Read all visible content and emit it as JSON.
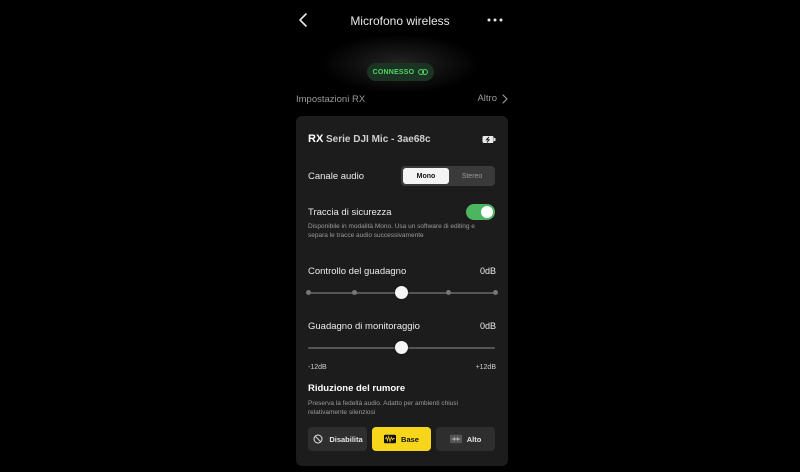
{
  "header": {
    "title": "Microfono wireless",
    "back_icon": "chevron-left-icon",
    "more_icon": "more-horizontal-icon"
  },
  "status": {
    "label": "CONNESSO",
    "icon": "link-icon",
    "color": "#54d26a"
  },
  "section": {
    "title": "Impostazioni RX",
    "more_label": "Altro",
    "more_icon": "chevron-right-icon"
  },
  "device": {
    "badge": "RX",
    "name": "Serie DJI Mic - 3ae68c",
    "battery_icon": "battery-charging-icon"
  },
  "audio_channel": {
    "label": "Canale audio",
    "options": [
      "Mono",
      "Stereo"
    ],
    "selected": "Mono"
  },
  "safety_track": {
    "label": "Traccia di sicurezza",
    "enabled": true,
    "description_line1": "Disponibile in modalità Mono. Usa un software di editing e",
    "description_line2": "separa le tracce audio successivamente",
    "toggle_color": "#4cb560"
  },
  "gain_control": {
    "label": "Controllo del guadagno",
    "value": "0dB",
    "steps": 5,
    "selected_step_fraction": 0.5
  },
  "monitor_gain": {
    "label": "Guadagno di monitoraggio",
    "value": "0dB",
    "min_label": "-12dB",
    "max_label": "+12dB",
    "level_fraction": 0.5
  },
  "noise_reduction": {
    "title": "Riduzione del rumore",
    "description_line1": "Preserva la fedeltà audio. Adatto per ambienti chiusi",
    "description_line2": "relativamente silenziosi",
    "options": [
      {
        "label": "Disabilita",
        "icon": "disabled-icon"
      },
      {
        "label": "Base",
        "icon": "waveform-basic-icon"
      },
      {
        "label": "Alto",
        "icon": "waveform-high-icon"
      }
    ],
    "selected": "Base",
    "accent_color": "#f7d51b"
  }
}
